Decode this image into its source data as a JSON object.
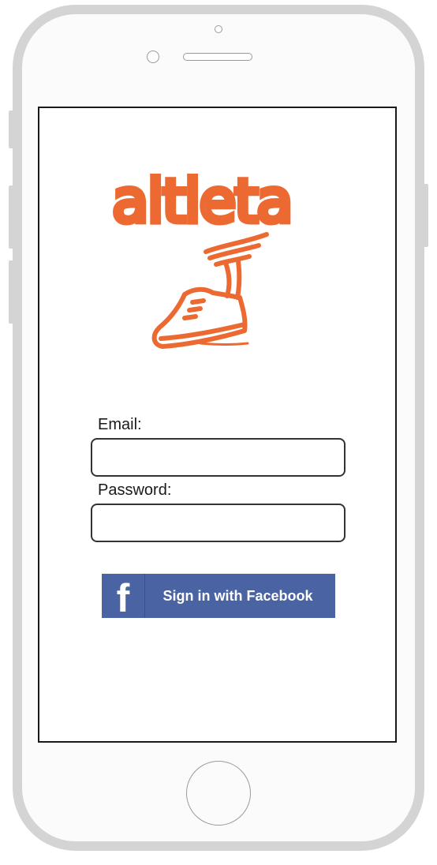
{
  "app": {
    "logo_text": "altleta",
    "brand_color": "#ec6a32"
  },
  "form": {
    "email_label": "Email:",
    "email_value": "",
    "password_label": "Password:",
    "password_value": ""
  },
  "facebook_button": {
    "icon_glyph": "f",
    "label": "Sign in with Facebook",
    "color": "#4a63a3"
  },
  "icons": {
    "logo": "winged-shoe-icon",
    "facebook": "facebook-icon"
  }
}
